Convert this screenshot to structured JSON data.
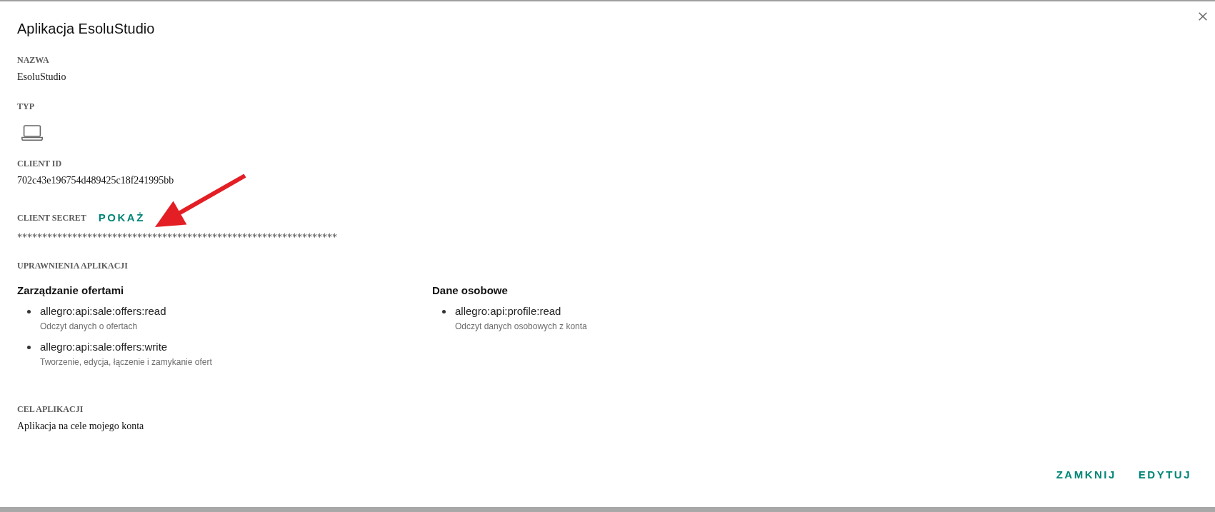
{
  "dialog": {
    "title": "Aplikacja EsoluStudio"
  },
  "fields": [
    {
      "kind": "text",
      "label": "NAZWA",
      "value": "EsoluStudio"
    },
    {
      "kind": "icon",
      "label": "TYP"
    },
    {
      "kind": "text",
      "label": "CLIENT ID",
      "value": "702c43e196754d489425c18f241995bb"
    },
    {
      "kind": "secret",
      "label": "CLIENT SECRET",
      "action": "POKAŻ",
      "value": "****************************************************************"
    }
  ],
  "permissions": {
    "label": "UPRAWNIENIA APLIKACJI",
    "groups": [
      {
        "title": "Zarządzanie ofertami",
        "scopes": [
          {
            "name": "allegro:api:sale:offers:read",
            "description": "Odczyt danych o ofertach"
          },
          {
            "name": "allegro:api:sale:offers:write",
            "description": "Tworzenie, edycja, łączenie i zamykanie ofert"
          }
        ]
      },
      {
        "title": "Dane osobowe",
        "scopes": [
          {
            "name": "allegro:api:profile:read",
            "description": "Odczyt danych osobowych z konta"
          }
        ]
      }
    ]
  },
  "purpose": {
    "label": "CEL APLIKACJI",
    "value": "Aplikacja na cele mojego konta"
  },
  "buttons": [
    "ZAMKNIJ",
    "EDYTUJ"
  ]
}
